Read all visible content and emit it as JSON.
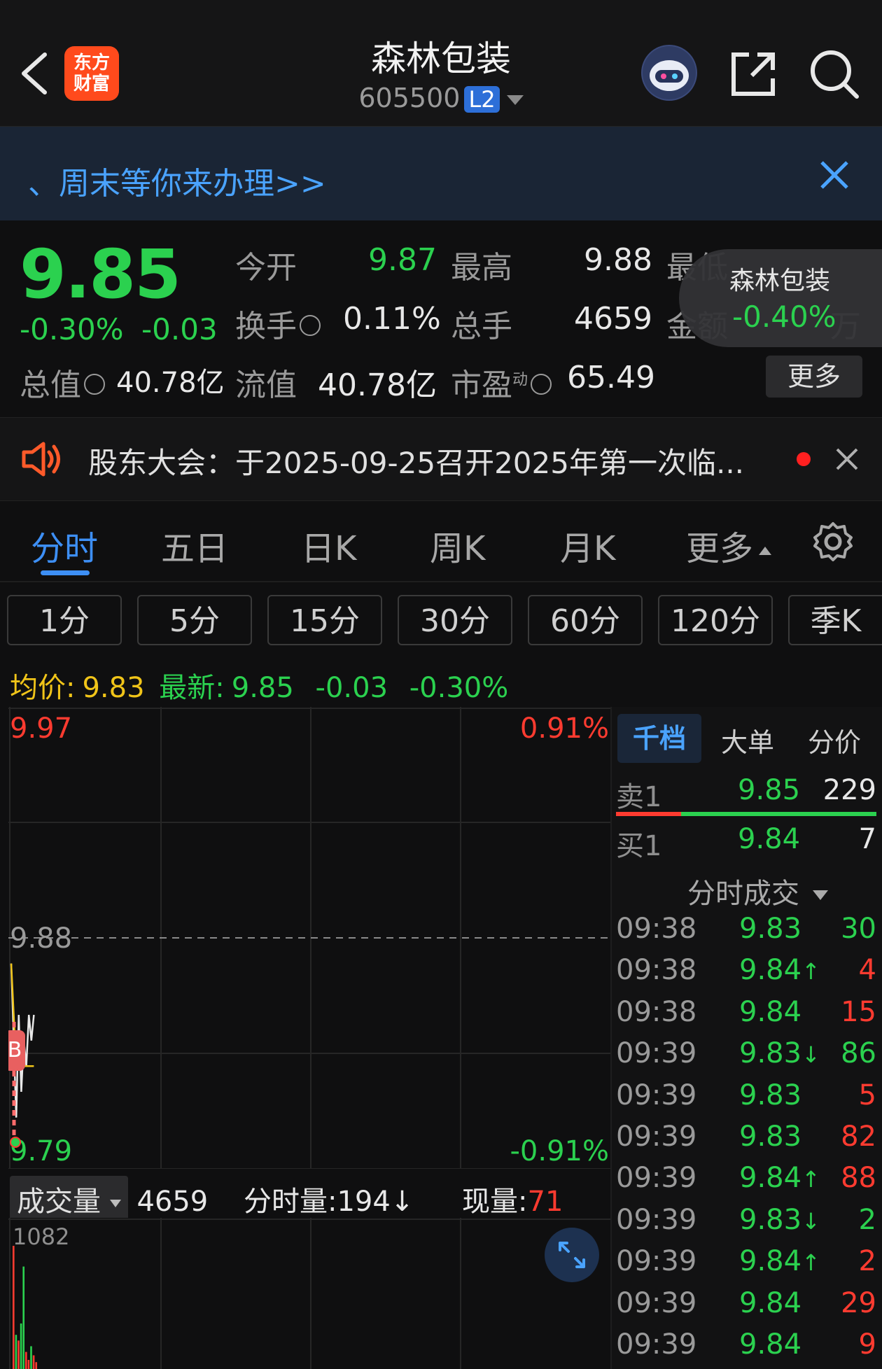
{
  "header": {
    "back_icon": "chevron-left-icon",
    "logo_line1": "东方",
    "logo_line2": "财富",
    "title": "森林包装",
    "code": "605500",
    "level_badge": "L2",
    "actions": [
      "robot-avatar-icon",
      "share-icon",
      "search-icon"
    ]
  },
  "banner": {
    "text": "、周末等你来办理>>"
  },
  "quote": {
    "price": "9.85",
    "change_pct": "-0.30%",
    "change": "-0.03",
    "open_label": "今开",
    "open": "9.87",
    "high_label": "最高",
    "high": "9.88",
    "low_label": "最低",
    "turnover_label": "换手",
    "turnover": "0.11%",
    "volume_label": "总手",
    "volume": "4659",
    "amount_label": "金额",
    "amount_unit": "万",
    "mktcap_label": "总值",
    "mktcap": "40.78亿",
    "float_label": "流值",
    "float_cap": "40.78亿",
    "pe_label": "市盈",
    "pe_sup": "动",
    "pe": "65.49",
    "more_label": "更多",
    "floater_name": "森林包装",
    "floater_pct": "-0.40%"
  },
  "notice": {
    "text": "股东大会：于2025-09-25召开2025年第一次临..."
  },
  "tabs": [
    "分时",
    "五日",
    "日K",
    "周K",
    "月K",
    "更多"
  ],
  "intervals": [
    "1分",
    "5分",
    "15分",
    "30分",
    "60分",
    "120分",
    "季K"
  ],
  "stats": {
    "avg_label": "均价:",
    "avg": "9.83",
    "latest_label": "最新:",
    "latest": "9.85",
    "chg": "-0.03",
    "pct": "-0.30%"
  },
  "chart_data": {
    "type": "line",
    "y_top": "9.97",
    "y_mid": "9.88",
    "y_bottom": "9.79",
    "pct_top": "0.91%",
    "pct_bottom": "-0.91%",
    "ylim": [
      9.79,
      9.97
    ],
    "prev_close": 9.88,
    "marker_label": "B",
    "series": [
      {
        "values": [
          9.87,
          9.84,
          9.81,
          9.85,
          9.82,
          9.84,
          9.83,
          9.85,
          9.84,
          9.85
        ]
      },
      {
        "values": [
          9.87,
          9.85,
          9.83,
          9.83,
          9.83,
          9.83,
          9.83,
          9.83,
          9.83,
          9.83
        ]
      }
    ]
  },
  "volume_bar": {
    "label": "成交量",
    "total": "4659",
    "fs_label": "分时量:",
    "fs_value": "194",
    "fs_arrow": "↓",
    "now_label": "现量:",
    "now_value": "71",
    "max_label": "1082"
  },
  "volume_chart": {
    "ymax": 1082,
    "values": [
      1082,
      300,
      250,
      400,
      900,
      150,
      80,
      200,
      120,
      60
    ],
    "colors": [
      "red",
      "green",
      "red",
      "green",
      "green",
      "red",
      "red",
      "green",
      "red",
      "red"
    ]
  },
  "right_panel": {
    "tabs": [
      "千档",
      "大单",
      "分价"
    ],
    "sell": {
      "label": "卖1",
      "price": "9.85",
      "vol": "229"
    },
    "buy": {
      "label": "买1",
      "price": "9.84",
      "vol": "7"
    },
    "sell_ratio": 0.25,
    "fold_label": "分时成交",
    "trades": [
      {
        "t": "09:38",
        "p": "9.83",
        "a": "",
        "v": "30",
        "c": "green"
      },
      {
        "t": "09:38",
        "p": "9.84",
        "a": "↑",
        "v": "4",
        "c": "red"
      },
      {
        "t": "09:38",
        "p": "9.84",
        "a": "",
        "v": "15",
        "c": "red"
      },
      {
        "t": "09:39",
        "p": "9.83",
        "a": "↓",
        "v": "86",
        "c": "green"
      },
      {
        "t": "09:39",
        "p": "9.83",
        "a": "",
        "v": "5",
        "c": "red"
      },
      {
        "t": "09:39",
        "p": "9.83",
        "a": "",
        "v": "82",
        "c": "red"
      },
      {
        "t": "09:39",
        "p": "9.84",
        "a": "↑",
        "v": "88",
        "c": "red"
      },
      {
        "t": "09:39",
        "p": "9.83",
        "a": "↓",
        "v": "2",
        "c": "green"
      },
      {
        "t": "09:39",
        "p": "9.84",
        "a": "↑",
        "v": "2",
        "c": "red"
      },
      {
        "t": "09:39",
        "p": "9.84",
        "a": "",
        "v": "29",
        "c": "red"
      },
      {
        "t": "09:39",
        "p": "9.84",
        "a": "",
        "v": "9",
        "c": "red"
      }
    ]
  },
  "colors": {
    "up": "#ff3b30",
    "down": "#2bd14f",
    "accent": "#3d8ff5",
    "avg_line": "#f0c419"
  }
}
